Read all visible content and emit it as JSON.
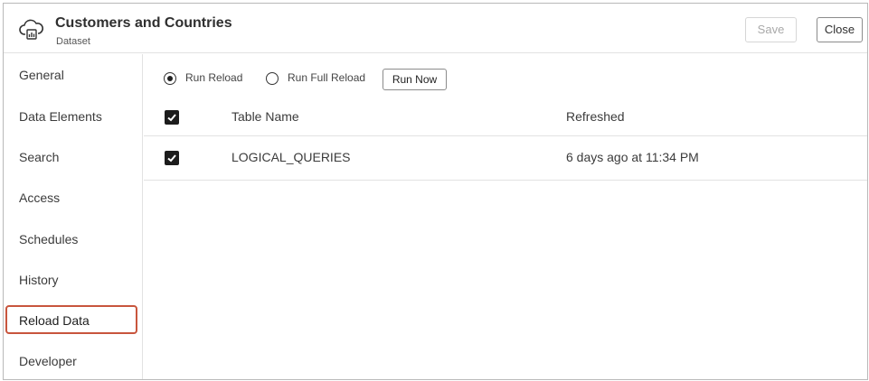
{
  "header": {
    "title": "Customers and Countries",
    "subtitle": "Dataset",
    "save_label": "Save",
    "close_label": "Close",
    "logo_icon": "cloud-dataset-icon"
  },
  "sidebar": {
    "items": [
      {
        "label": "General"
      },
      {
        "label": "Data Elements"
      },
      {
        "label": "Search"
      },
      {
        "label": "Access"
      },
      {
        "label": "Schedules"
      },
      {
        "label": "History"
      },
      {
        "label": "Reload Data",
        "active": true
      },
      {
        "label": "Developer"
      }
    ],
    "active_border_color": "#c8553d"
  },
  "reload": {
    "option_reload": "Run Reload",
    "option_full_reload": "Run Full Reload",
    "selected_option": "Run Reload",
    "run_now_label": "Run Now"
  },
  "table": {
    "columns": [
      "Table Name",
      "Refreshed"
    ],
    "header_checked": true,
    "rows": [
      {
        "checked": true,
        "name": "LOGICAL_QUERIES",
        "refreshed": "6 days ago at 11:34 PM"
      }
    ]
  }
}
